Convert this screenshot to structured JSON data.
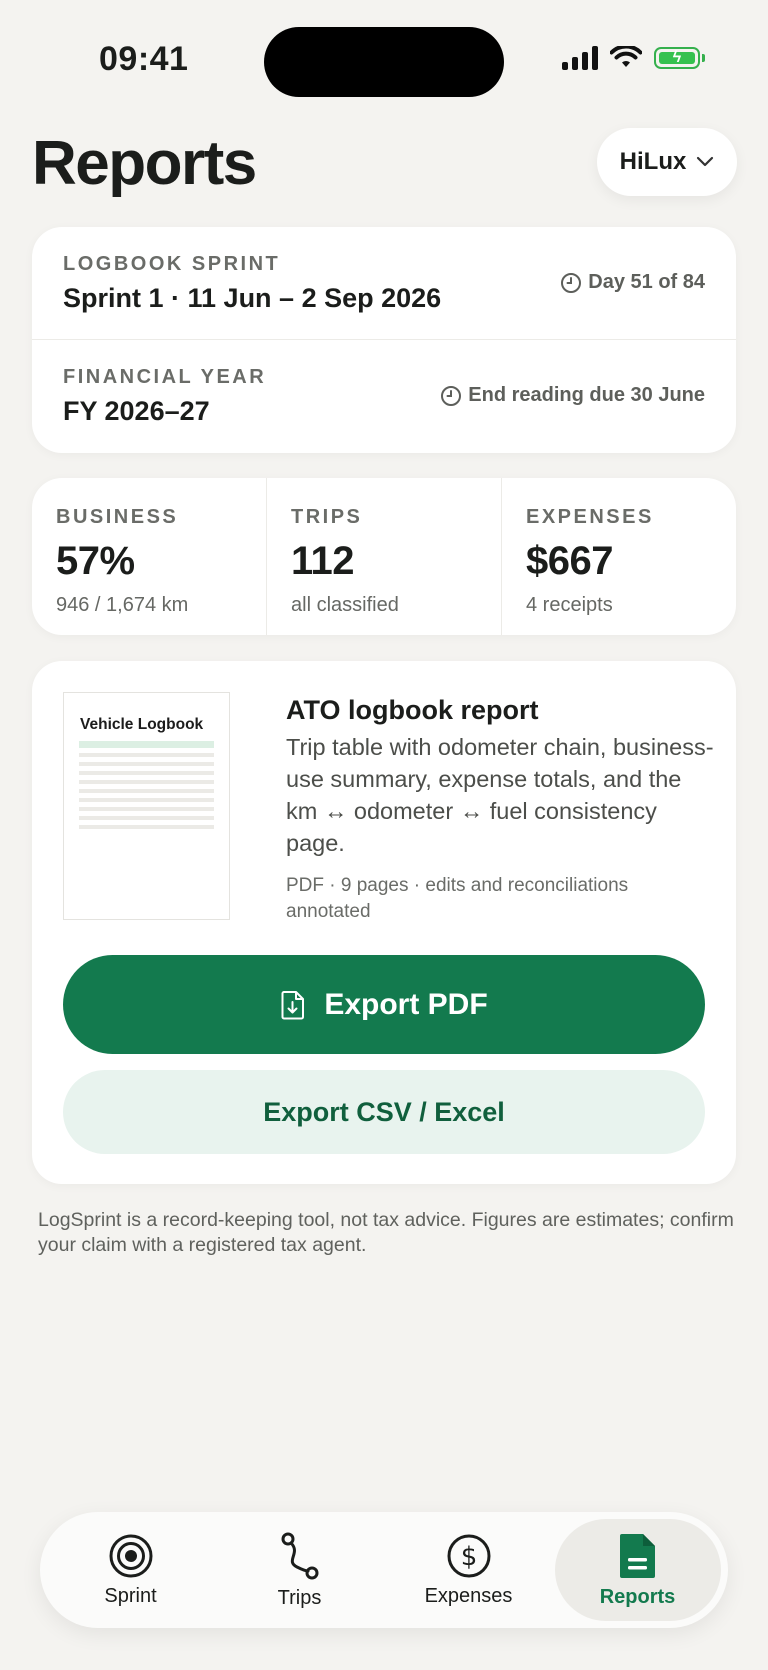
{
  "status_bar": {
    "time": "09:41"
  },
  "header": {
    "title": "Reports",
    "vehicle": "HiLux"
  },
  "sprint": {
    "eyebrow": "LOGBOOK SPRINT",
    "value": "Sprint 1 · 11 Jun – 2 Sep 2026",
    "meta": "Day 51 of 84"
  },
  "financial_year": {
    "eyebrow": "FINANCIAL YEAR",
    "value": "FY 2026–27",
    "meta": "End reading due 30 June"
  },
  "stats": [
    {
      "label": "BUSINESS",
      "value": "57%",
      "sub": "946 / 1,674 km"
    },
    {
      "label": "TRIPS",
      "value": "112",
      "sub": "all classified"
    },
    {
      "label": "EXPENSES",
      "value": "$667",
      "sub": "4 receipts"
    }
  ],
  "report": {
    "thumbnail_title": "Vehicle Logbook",
    "title": "ATO logbook report",
    "description": "Trip table with odometer chain, business-use summary, expense totals, and the km ↔ odometer ↔ fuel consistency page.",
    "meta": "PDF · 9 pages · edits and reconciliations annotated",
    "export_pdf": "Export PDF",
    "export_csv": "Export CSV / Excel"
  },
  "disclaimer": "LogSprint is a record-keeping tool, not tax advice. Figures are estimates; confirm your claim with a registered tax agent.",
  "tabs": [
    {
      "label": "Sprint",
      "icon": "target-icon",
      "active": false
    },
    {
      "label": "Trips",
      "icon": "route-icon",
      "active": false
    },
    {
      "label": "Expenses",
      "icon": "dollar-icon",
      "active": false
    },
    {
      "label": "Reports",
      "icon": "document-icon",
      "active": true
    }
  ],
  "colors": {
    "accent": "#137a4e",
    "accent_soft": "#e8f3ee",
    "background": "#f4f3f0"
  }
}
